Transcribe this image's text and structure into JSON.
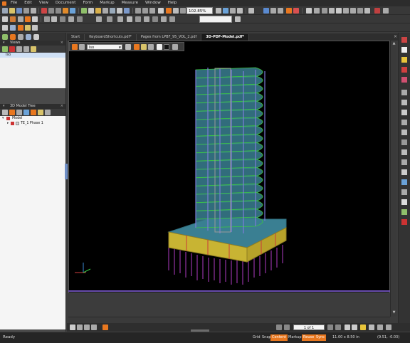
{
  "menu": {
    "items": [
      "File",
      "Edit",
      "View",
      "Document",
      "Form",
      "Markup",
      "Measure",
      "Window",
      "Help"
    ]
  },
  "toolbar": {
    "zoom_value": "102.85%"
  },
  "left_panel": {
    "views_title": "Views",
    "views_item": "Iso",
    "tree_title": "3D Model Tree",
    "tree_root": "Model",
    "tree_child": "TE_1 Phase 1"
  },
  "tabs": [
    {
      "label": "Start"
    },
    {
      "label": "KeyboardShortcuts.pdf*"
    },
    {
      "label": "Pages from LPBF_95_VOL_2.pdf"
    },
    {
      "label": "3D-PDF-Model.pdf*"
    }
  ],
  "model_toolbar": {
    "view_select": "Iso"
  },
  "navigation": {
    "page_label": "1 of 1"
  },
  "status": {
    "ready": "Ready",
    "toggles": [
      {
        "label": "Grid",
        "on": false
      },
      {
        "label": "Snap",
        "on": false
      },
      {
        "label": "Content",
        "on": true
      },
      {
        "label": "Markup",
        "on": false
      },
      {
        "label": "Reuse",
        "on": true
      },
      {
        "label": "Sync",
        "on": true
      }
    ],
    "page_size": "11.00 x 8.50 in",
    "coords": "(9.51, -0.03)"
  },
  "colors": {
    "accent": "#e8771f",
    "viewer_bg": "#000000",
    "podium": "#c8b433",
    "slab_top": "#3a7f92",
    "piles": "#b13cc3",
    "columns": "#7c7cd8",
    "slab_edge": "#3cc840"
  }
}
